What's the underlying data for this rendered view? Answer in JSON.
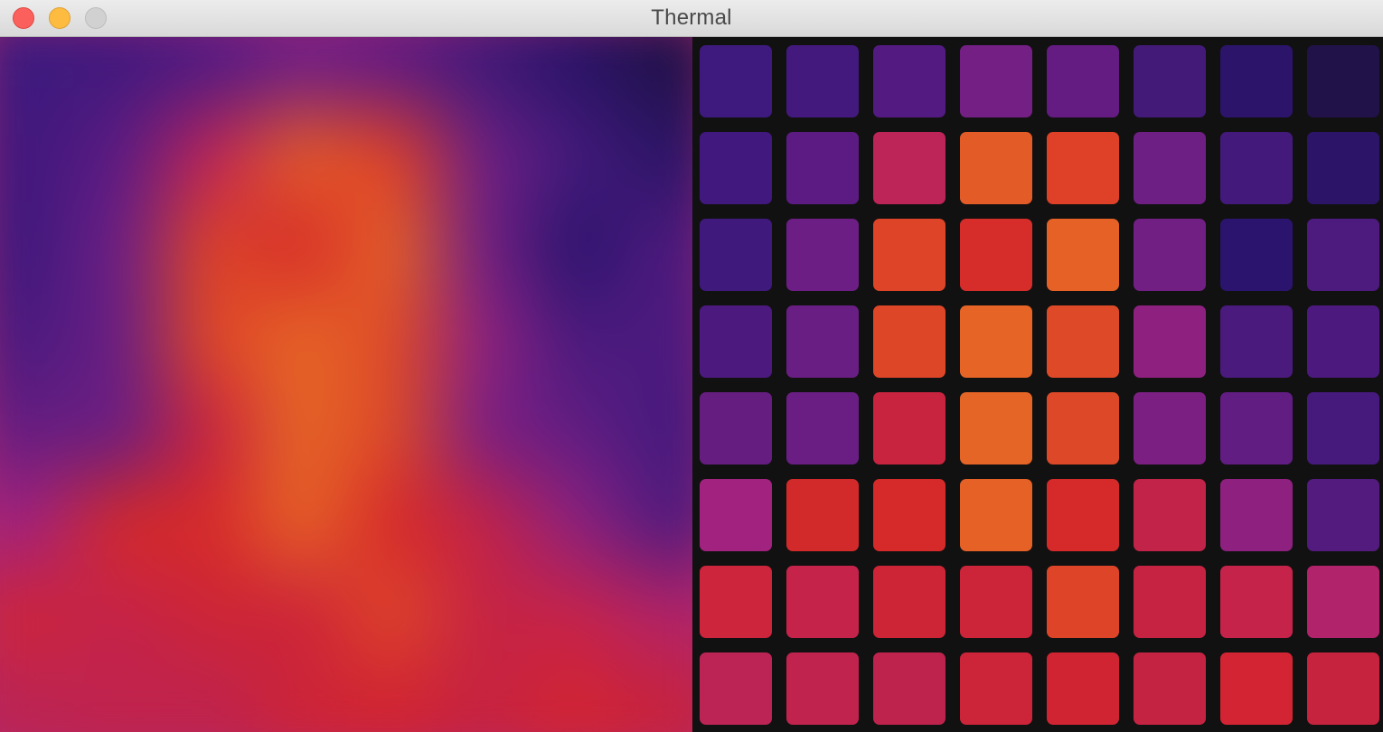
{
  "window": {
    "title": "Thermal"
  },
  "traffic_lights": [
    {
      "name": "close",
      "color": "#fc605c"
    },
    {
      "name": "minimize",
      "color": "#fdbc40"
    },
    {
      "name": "zoom",
      "color": "#d1d1d1"
    }
  ],
  "sensor_grid": {
    "rows": 8,
    "cols": 8,
    "colors": [
      [
        "#3e1a7e",
        "#43197d",
        "#531b82",
        "#741f84",
        "#641b82",
        "#431a78",
        "#2b1469",
        "#22124a"
      ],
      [
        "#41187d",
        "#5c1b83",
        "#bd2458",
        "#e35c28",
        "#de4128",
        "#6e1f83",
        "#431a7b",
        "#2c1568"
      ],
      [
        "#40197d",
        "#6d1e85",
        "#dd4428",
        "#d62d2a",
        "#e56126",
        "#721f83",
        "#2b146d",
        "#4d1a7d"
      ],
      [
        "#4c1a7f",
        "#691e83",
        "#de4628",
        "#e66526",
        "#de4a28",
        "#8e217f",
        "#4a1a7d",
        "#4c1a7e"
      ],
      [
        "#661d80",
        "#6a1e83",
        "#c8243f",
        "#e56526",
        "#dd4928",
        "#7c1f83",
        "#611d82",
        "#461a7d"
      ],
      [
        "#a1227f",
        "#d22a2a",
        "#d62a2a",
        "#e56126",
        "#d62a2a",
        "#c22348",
        "#8e217f",
        "#521b7d"
      ],
      [
        "#cd253b",
        "#c5234a",
        "#cd2536",
        "#cc2439",
        "#de4528",
        "#c62343",
        "#c6234a",
        "#b1236a"
      ],
      [
        "#bb2454",
        "#c0234d",
        "#be234d",
        "#cc2439",
        "#d12432",
        "#c52342",
        "#d22432",
        "#c6233f"
      ]
    ]
  }
}
